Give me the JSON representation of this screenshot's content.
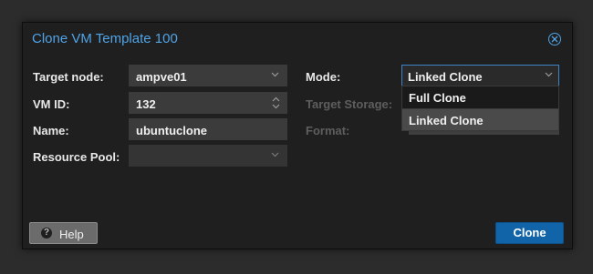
{
  "dialog": {
    "title": "Clone VM Template 100"
  },
  "form": {
    "target_node": {
      "label": "Target node:",
      "value": "ampve01"
    },
    "vm_id": {
      "label": "VM ID:",
      "value": "132"
    },
    "name": {
      "label": "Name:",
      "value": "ubuntuclone"
    },
    "resource_pool": {
      "label": "Resource Pool:",
      "value": ""
    },
    "mode": {
      "label": "Mode:",
      "value": "Linked Clone",
      "options": [
        "Full Clone",
        "Linked Clone"
      ],
      "selected_option": "Linked Clone"
    },
    "target_storage": {
      "label": "Target Storage:"
    },
    "format": {
      "label": "Format:"
    }
  },
  "buttons": {
    "help": "Help",
    "clone": "Clone"
  },
  "colors": {
    "accent": "#4fa3e6",
    "primary_button": "#1264a8"
  },
  "icons": {
    "close": "close-circle-icon",
    "help": "question-circle-icon"
  }
}
